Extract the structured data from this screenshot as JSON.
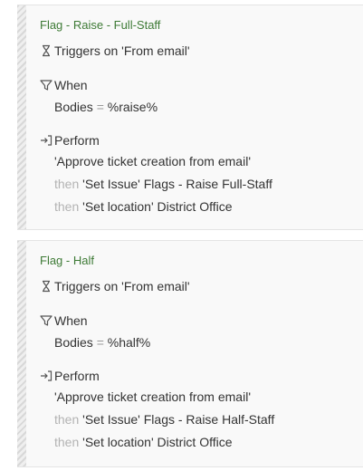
{
  "rules": [
    {
      "title": "Flag - Raise - Full-Staff",
      "trigger": "Triggers on 'From email'",
      "when_label": "When",
      "condition": {
        "field": "Bodies",
        "op": "=",
        "value": "%raise%"
      },
      "perform_label": "Perform",
      "actions": [
        {
          "prefix": "",
          "name": "'Approve ticket creation from email'",
          "detail": ""
        },
        {
          "prefix": "then",
          "name": "'Set Issue'",
          "detail": "Flags - Raise Full-Staff"
        },
        {
          "prefix": "then",
          "name": "'Set location'",
          "detail": "District Office"
        }
      ]
    },
    {
      "title": "Flag - Half",
      "trigger": "Triggers on 'From email'",
      "when_label": "When",
      "condition": {
        "field": "Bodies",
        "op": "=",
        "value": "%half%"
      },
      "perform_label": "Perform",
      "actions": [
        {
          "prefix": "",
          "name": "'Approve ticket creation from email'",
          "detail": ""
        },
        {
          "prefix": "then",
          "name": "'Set Issue'",
          "detail": "Flags - Raise Half-Staff"
        },
        {
          "prefix": "then",
          "name": "'Set location'",
          "detail": "District Office"
        }
      ]
    }
  ],
  "icons": {
    "trigger": "hourglass-icon",
    "when": "filter-icon",
    "perform": "sign-in-arrow-icon"
  },
  "colors": {
    "title_green": "#3d7a35",
    "muted_text": "#b3b3b3",
    "card_bg": "#f9f9f9"
  }
}
